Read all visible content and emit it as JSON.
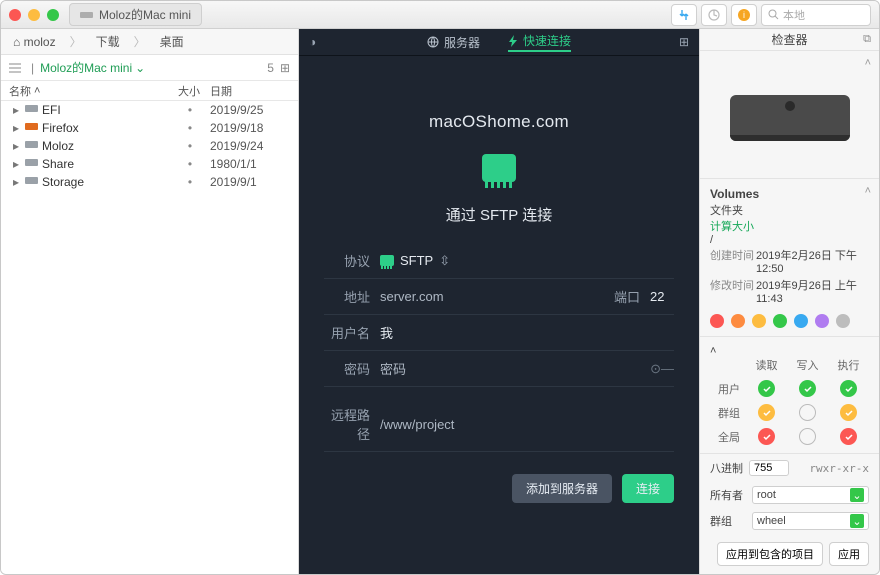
{
  "titlebar": {
    "tab_title": "Moloz的Mac mini"
  },
  "toolbar_search": {
    "placeholder": "本地"
  },
  "pathbar": {
    "items": [
      "moloz",
      "下载",
      "桌面"
    ]
  },
  "left": {
    "location": "Moloz的Mac mini",
    "count": "5",
    "columns": {
      "name": "名称",
      "size": "大小",
      "date": "日期"
    },
    "rows": [
      {
        "name": "EFI",
        "size": "•",
        "date": "2019/9/25",
        "icon": "disk"
      },
      {
        "name": "Firefox",
        "size": "•",
        "date": "2019/9/18",
        "icon": "firefox"
      },
      {
        "name": "Moloz",
        "size": "•",
        "date": "2019/9/24",
        "icon": "disk"
      },
      {
        "name": "Share",
        "size": "•",
        "date": "1980/1/1",
        "icon": "disk"
      },
      {
        "name": "Storage",
        "size": "•",
        "date": "2019/9/1",
        "icon": "disk"
      }
    ]
  },
  "center": {
    "tabs": {
      "server": "服务器",
      "quick": "快速连接"
    },
    "brand": "macOShome.com",
    "heading": "通过 SFTP 连接",
    "labels": {
      "protocol": "协议",
      "address": "地址",
      "port": "端口",
      "username": "用户名",
      "password": "密码",
      "remote_path": "远程路径"
    },
    "values": {
      "protocol": "SFTP",
      "address": "server.com",
      "port": "22",
      "username": "我",
      "password": "密码",
      "remote_path": "/www/project"
    },
    "buttons": {
      "add": "添加到服务器",
      "connect": "连接"
    }
  },
  "right": {
    "title": "检查器",
    "volumes_title": "Volumes",
    "type": "文件夹",
    "calc": "计算大小",
    "path": "/",
    "created_label": "创建时间",
    "created": "2019年2月26日 下午12:50",
    "modified_label": "修改时间",
    "modified": "2019年9月26日 上午11:43",
    "tag_colors": [
      "#fc5753",
      "#fd8b40",
      "#fdbc40",
      "#34c749",
      "#38a9f0",
      "#b07cf0",
      "#bdbdbd"
    ],
    "perm": {
      "read": "读取",
      "write": "写入",
      "exec": "执行",
      "user": "用户",
      "group": "群组",
      "global": "全局"
    },
    "octal_label": "八进制",
    "octal": "755",
    "perm_str": "rwxr-xr-x",
    "owner_label": "所有者",
    "owner": "root",
    "group_label": "群组",
    "group": "wheel",
    "apply_contained": "应用到包含的项目",
    "apply": "应用"
  }
}
